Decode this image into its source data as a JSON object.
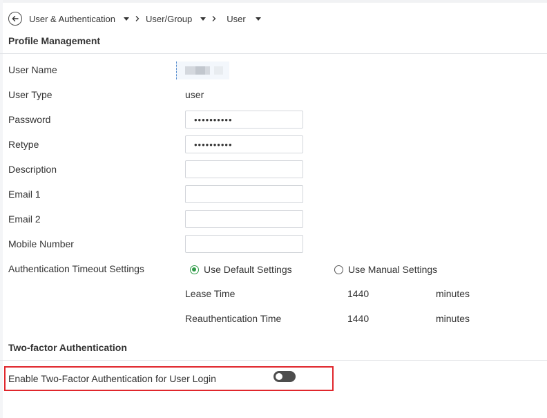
{
  "breadcrumb": {
    "items": [
      {
        "label": "User & Authentication"
      },
      {
        "label": "User/Group"
      },
      {
        "label": "User"
      }
    ]
  },
  "profile": {
    "section_title": "Profile Management",
    "user_name_label": "User Name",
    "user_type_label": "User Type",
    "user_type_value": "user",
    "password_label": "Password",
    "password_value": "••••••••••",
    "retype_label": "Retype",
    "retype_value": "••••••••••",
    "description_label": "Description",
    "description_value": "",
    "email1_label": "Email 1",
    "email1_value": "",
    "email2_label": "Email 2",
    "email2_value": "",
    "mobile_label": "Mobile Number",
    "mobile_value": ""
  },
  "auth_timeout": {
    "label": "Authentication Timeout Settings",
    "option_default": "Use Default Settings",
    "option_manual": "Use Manual Settings",
    "selected": "default",
    "lease_time_label": "Lease Time",
    "lease_time_value": "1440",
    "lease_time_unit": "minutes",
    "reauth_label": "Reauthentication Time",
    "reauth_value": "1440",
    "reauth_unit": "minutes"
  },
  "two_factor": {
    "section_title": "Two-factor Authentication",
    "enable_label": "Enable Two-Factor Authentication for User Login",
    "enabled": false
  },
  "colors": {
    "accent_green": "#2e9a47",
    "highlight_red": "#e0262c",
    "toggle_off": "#4d4d4d"
  },
  "icons": {
    "back": "back-arrow-circle-icon",
    "dropdown": "caret-down-icon",
    "separator": "chevron-right-icon"
  }
}
